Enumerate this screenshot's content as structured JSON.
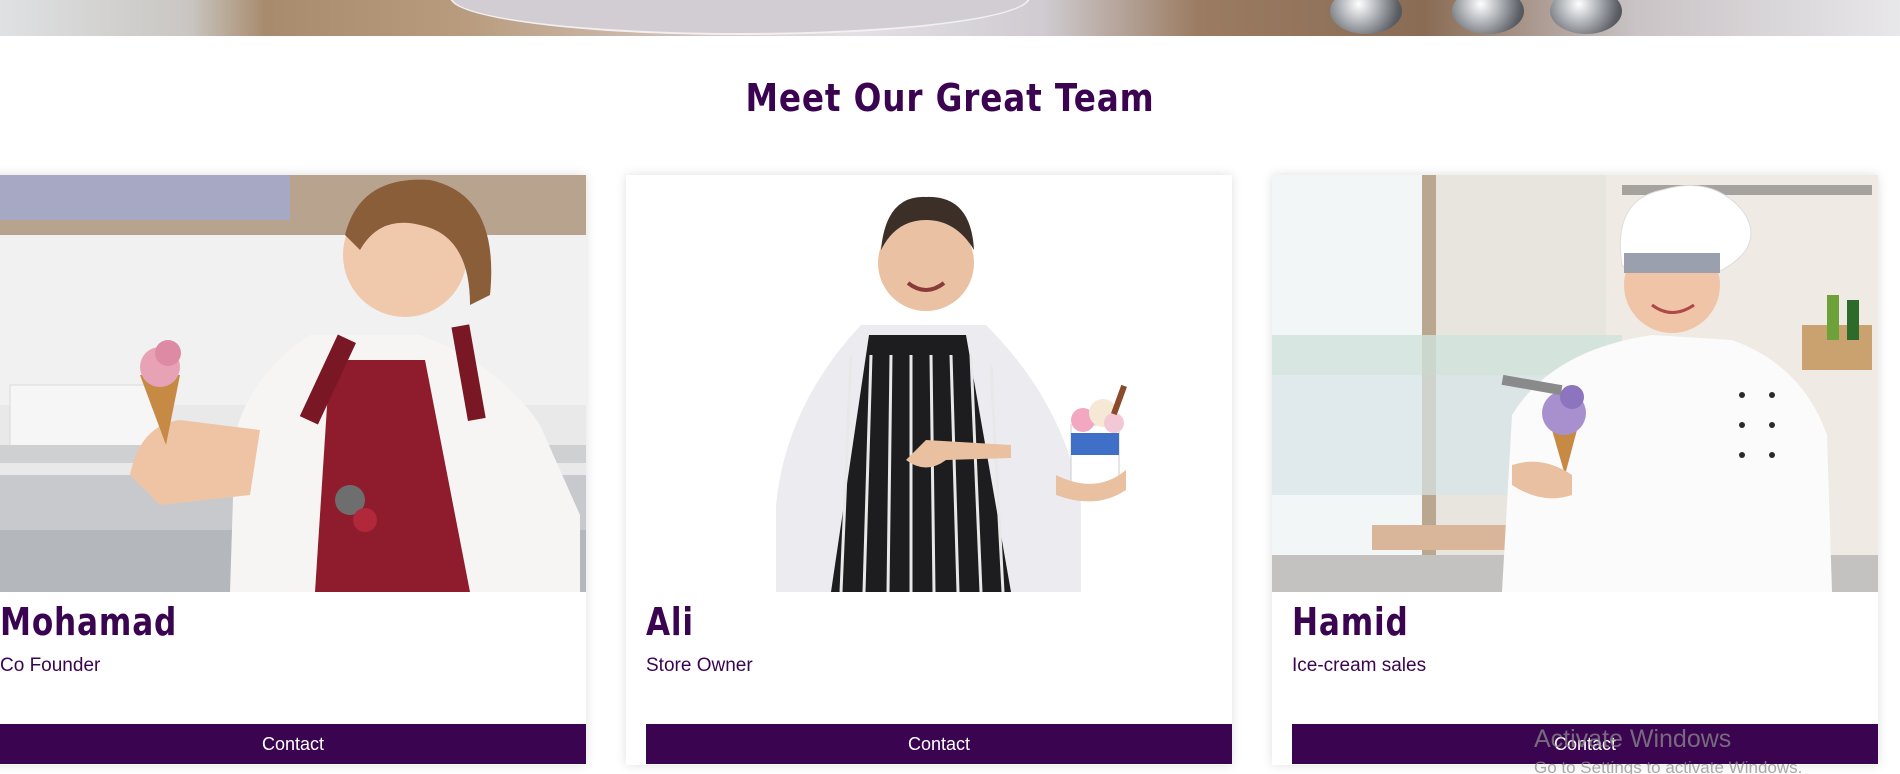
{
  "section": {
    "title": "Meet Our Great Team"
  },
  "team": [
    {
      "name": "Mohamad",
      "role": "Co Founder",
      "button_label": "Contact"
    },
    {
      "name": "Ali",
      "role": "Store Owner",
      "button_label": "Contact"
    },
    {
      "name": "Hamid",
      "role": "Ice-cream sales",
      "button_label": "Contact"
    }
  ],
  "watermark": {
    "title": "Activate Windows",
    "subtitle": "Go to Settings to activate Windows."
  },
  "colors": {
    "accent": "#3a0450",
    "background": "#ffffff"
  }
}
